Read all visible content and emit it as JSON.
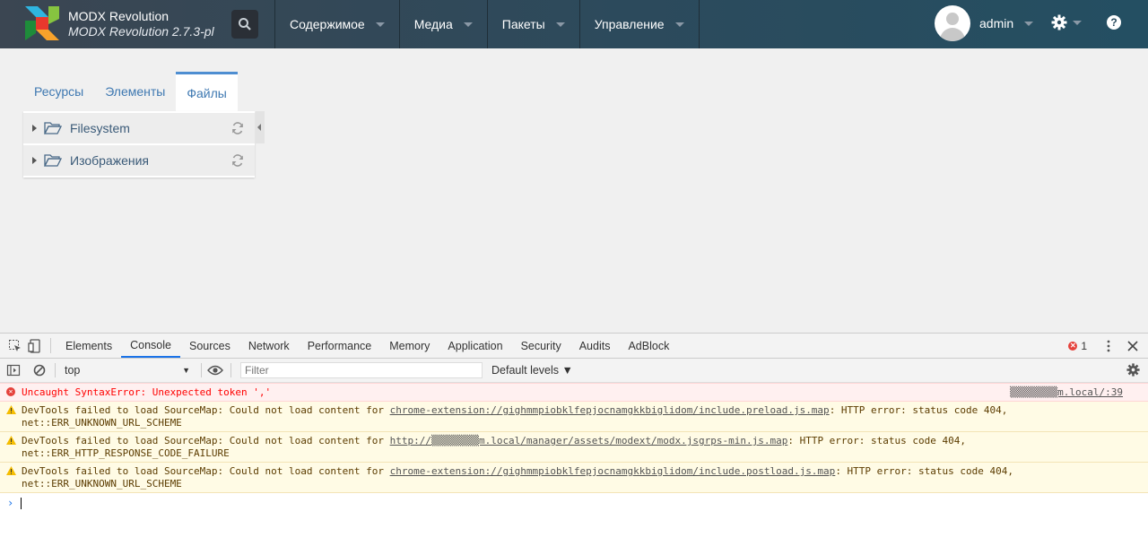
{
  "header": {
    "brand_title": "MODX Revolution",
    "brand_version": "MODX Revolution 2.7.3-pl",
    "nav": [
      {
        "label": "Содержимое"
      },
      {
        "label": "Медиа"
      },
      {
        "label": "Пакеты"
      },
      {
        "label": "Управление"
      }
    ],
    "username": "admin",
    "help_label": "?"
  },
  "sidebar": {
    "tabs": [
      {
        "label": "Ресурсы",
        "active": false
      },
      {
        "label": "Элементы",
        "active": false
      },
      {
        "label": "Файлы",
        "active": true
      }
    ],
    "tree": [
      {
        "label": "Filesystem",
        "icon": "folder-icon"
      },
      {
        "label": "Изображения",
        "icon": "folder-icon"
      }
    ]
  },
  "devtools": {
    "tabs": [
      "Elements",
      "Console",
      "Sources",
      "Network",
      "Performance",
      "Memory",
      "Application",
      "Security",
      "Audits",
      "AdBlock"
    ],
    "active_tab": "Console",
    "error_count": "1",
    "context": "top",
    "filter_placeholder": "Filter",
    "levels_label": "Default levels ▼",
    "messages": [
      {
        "level": "error",
        "text": "Uncaught SyntaxError: Unexpected token ','",
        "source": "▒▒▒▒▒▒▒▒m.local/:39"
      },
      {
        "level": "warn",
        "prefix": "DevTools failed to load SourceMap: Could not load content for ",
        "url": "chrome-extension://gighmmpiobklfepjocnamgkkbiglidom/include.preload.js.map",
        "suffix": ": HTTP error: status code 404,",
        "line2": "net::ERR_UNKNOWN_URL_SCHEME"
      },
      {
        "level": "warn",
        "prefix": "DevTools failed to load SourceMap: Could not load content for ",
        "url": "http://▒▒▒▒▒▒▒▒m.local/manager/assets/modext/modx.jsgrps-min.js.map",
        "suffix": ": HTTP error: status code 404,",
        "line2": "net::ERR_HTTP_RESPONSE_CODE_FAILURE"
      },
      {
        "level": "warn",
        "prefix": "DevTools failed to load SourceMap: Could not load content for ",
        "url": "chrome-extension://gighmmpiobklfepjocnamgkkbiglidom/include.postload.js.map",
        "suffix": ": HTTP error: status code 404,",
        "line2": "net::ERR_UNKNOWN_URL_SCHEME"
      }
    ],
    "prompt_symbol": "›"
  },
  "colors": {
    "accent": "#4e8ed1",
    "link": "#3e78b1",
    "error": "#ff0000",
    "warning_bg": "#fffbe5"
  }
}
